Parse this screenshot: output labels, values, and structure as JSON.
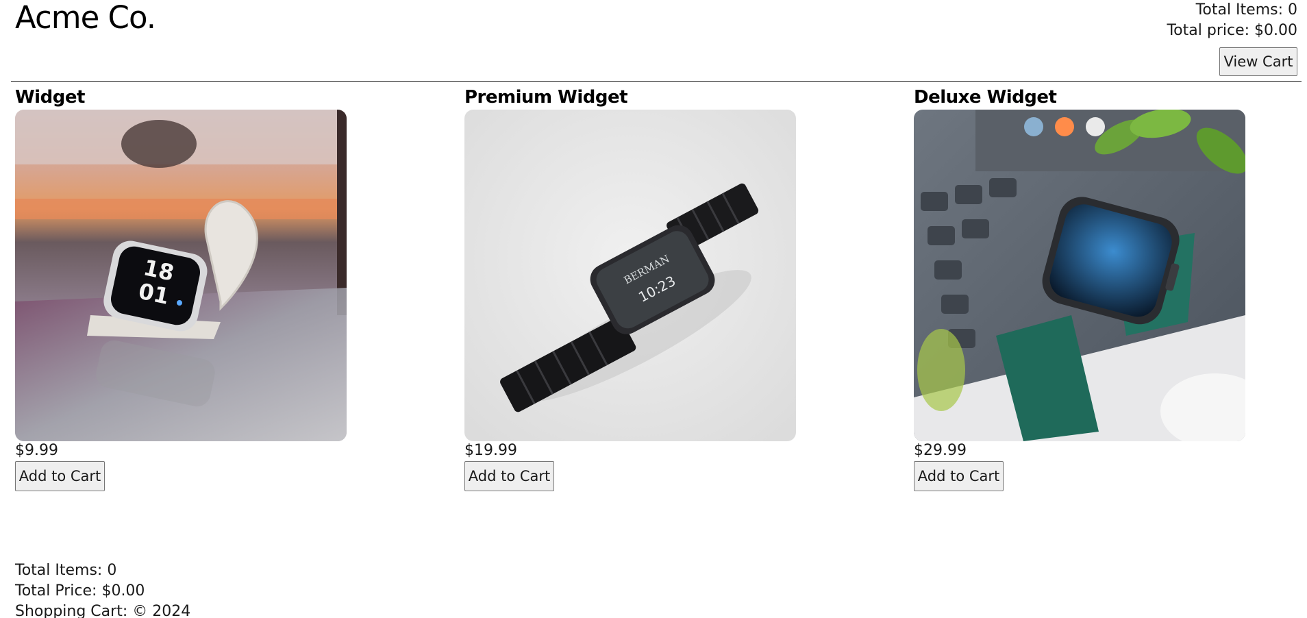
{
  "header": {
    "brand": "Acme Co.",
    "total_items": "Total Items: 0",
    "total_price": "Total price: $0.00",
    "view_cart_label": "View Cart"
  },
  "products": [
    {
      "name": "Widget",
      "price": "$9.99",
      "add_label": "Add to Cart",
      "image_icon": "white-smartwatch-image"
    },
    {
      "name": "Premium Widget",
      "price": "$19.99",
      "add_label": "Add to Cart",
      "image_icon": "black-link-smartwatch-image",
      "watch_face": {
        "brand": "BERMAN",
        "time": "10:23"
      }
    },
    {
      "name": "Deluxe Widget",
      "price": "$29.99",
      "add_label": "Add to Cart",
      "image_icon": "green-leather-smartwatch-image"
    }
  ],
  "footer": {
    "total_items": "Total Items: 0",
    "total_price": "Total Price: $0.00",
    "copyright": "Shopping Cart: © 2024"
  },
  "colors": {
    "button_bg": "#efefef",
    "button_border": "#767676",
    "text": "#1a1a1a"
  }
}
